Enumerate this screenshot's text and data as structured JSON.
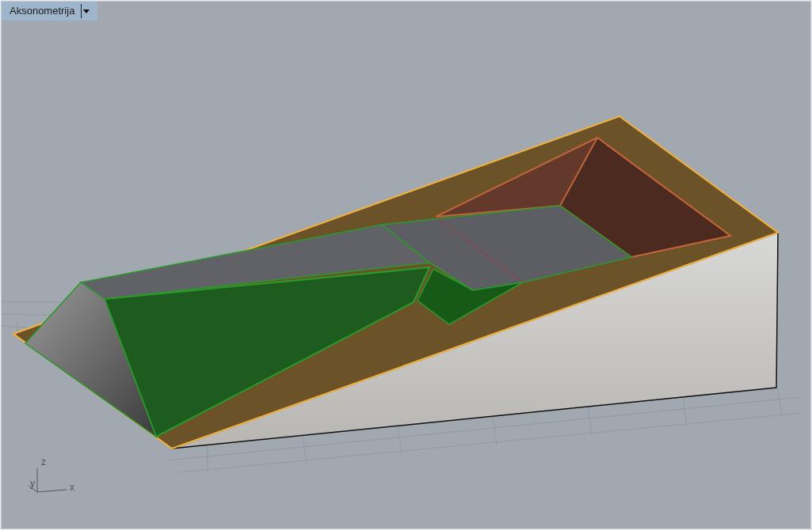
{
  "viewport": {
    "title": "Aksonometrija",
    "axes": [
      {
        "label": "z"
      },
      {
        "label": "y"
      },
      {
        "label": "x"
      }
    ]
  }
}
